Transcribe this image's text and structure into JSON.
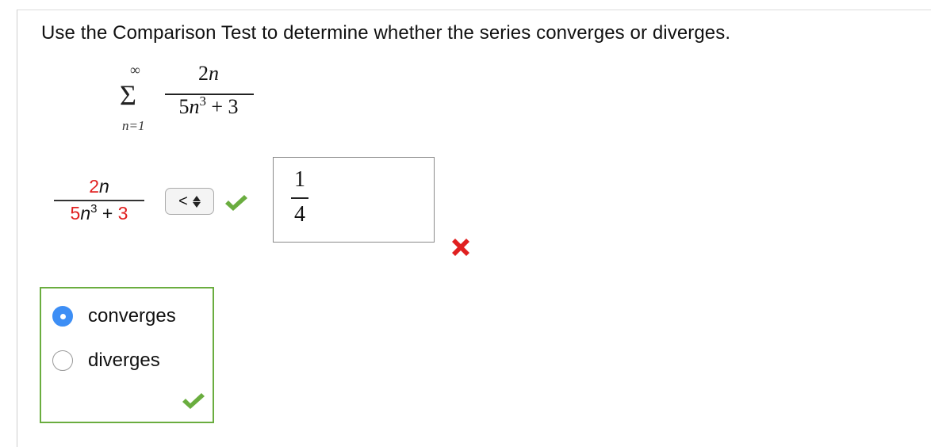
{
  "question": "Use the Comparison Test to determine whether the series converges or diverges.",
  "series": {
    "upper": "∞",
    "symbol": "Σ",
    "lower": "n=1",
    "numerator_coef": "2",
    "numerator_var": "n",
    "denominator_coef": "5",
    "denominator_var": "n",
    "denominator_exp": "3",
    "denominator_tail": " + 3"
  },
  "comparison": {
    "numerator_coef": "2",
    "numerator_var": "n",
    "denominator_coef": "5",
    "denominator_var": "n",
    "denominator_exp": "3",
    "denominator_plus": " + ",
    "denominator_const": "3",
    "operator_selected": "<",
    "operator_status": "correct",
    "answer_numerator": "1",
    "answer_denominator": "4",
    "answer_status": "incorrect"
  },
  "choices": {
    "options": [
      {
        "label": "converges",
        "selected": true
      },
      {
        "label": "diverges",
        "selected": false
      }
    ],
    "status": "correct"
  },
  "colors": {
    "correct_green": "#6aad3f",
    "incorrect_red": "#e02020",
    "radio_selected": "#3d8ef5"
  }
}
